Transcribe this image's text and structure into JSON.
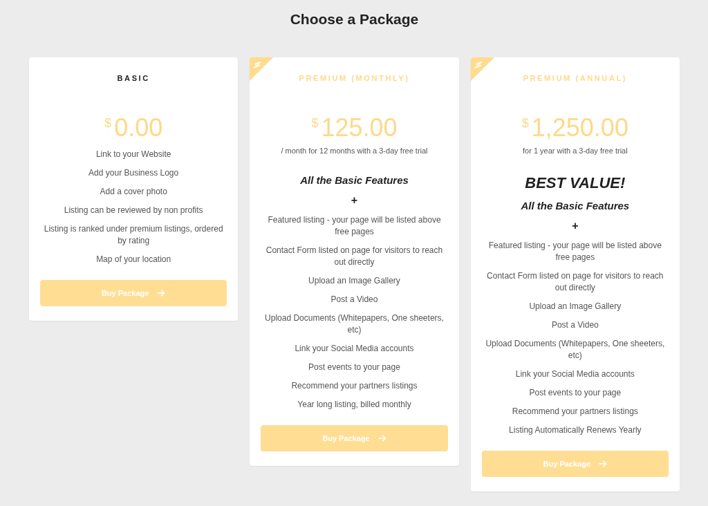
{
  "title": "Choose a Package",
  "packages": [
    {
      "name": "BASIC",
      "featured": false,
      "currency": "$",
      "price": "0.00",
      "features": [
        "Link to your Website",
        "Add your Business Logo",
        "Add a cover photo",
        "Listing can be reviewed by non profits",
        "Listing is ranked under premium listings, ordered by rating",
        "Map of your location"
      ],
      "button": "Buy Package"
    },
    {
      "name": "PREMIUM (MONTHLY)",
      "featured": true,
      "currency": "$",
      "price": "125.00",
      "term": "/ month for 12 months with a 3-day free trial",
      "highlights": [
        {
          "kind": "subheading",
          "text": "All the Basic Features"
        },
        {
          "kind": "plus",
          "text": "+"
        }
      ],
      "features": [
        "Featured listing - your page will be listed above free pages",
        "Contact Form listed on page for visitors to reach out directly",
        "Upload an Image Gallery",
        "Post a Video",
        "Upload Documents (Whitepapers, One sheeters, etc)",
        "Link your Social Media accounts",
        "Post events to your page",
        "Recommend your partners listings",
        "Year long listing, billed monthly"
      ],
      "button": "Buy Package"
    },
    {
      "name": "PREMIUM (ANNUAL)",
      "featured": true,
      "currency": "$",
      "price": "1,250.00",
      "term": "for 1 year with a 3-day free trial",
      "highlights": [
        {
          "kind": "headline",
          "text": "BEST VALUE!"
        },
        {
          "kind": "subheading",
          "text": "All the Basic Features"
        },
        {
          "kind": "plus",
          "text": "+"
        }
      ],
      "features": [
        "Featured listing - your page will be listed above free pages",
        "Contact Form listed on page for visitors to reach out directly",
        "Upload an Image Gallery",
        "Post a Video",
        "Upload Documents (Whitepapers, One sheeters, etc)",
        "Link your Social Media accounts",
        "Post events to your page",
        "Recommend your partners listings",
        "Listing Automatically Renews Yearly"
      ],
      "button": "Buy Package"
    }
  ]
}
